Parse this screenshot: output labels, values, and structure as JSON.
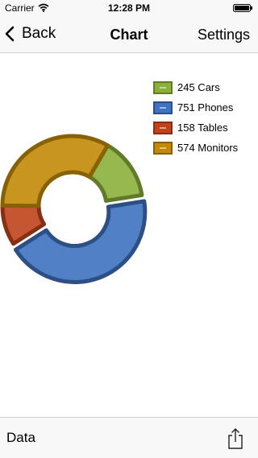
{
  "status_bar": {
    "carrier": "Carrier",
    "time": "12:28 PM",
    "wifi_icon": "wifi-icon",
    "battery_icon": "battery-icon"
  },
  "nav": {
    "back_label": "Back",
    "back_icon": "chevron-left-icon",
    "title": "Chart",
    "settings_label": "Settings"
  },
  "toolbar": {
    "data_label": "Data",
    "share_icon": "share-icon"
  },
  "chart_data": {
    "type": "pie",
    "title": "",
    "legend_position": "top-right",
    "slices": [
      {
        "label": "Cars",
        "value": 245,
        "color": "#8ab03a",
        "legend_text": "245 Cars",
        "exploded": false
      },
      {
        "label": "Phones",
        "value": 751,
        "color": "#3f72c0",
        "legend_text": "751 Phones",
        "exploded": true
      },
      {
        "label": "Tables",
        "value": 158,
        "color": "#c0431b",
        "legend_text": "158 Tables",
        "exploded": false
      },
      {
        "label": "Monitors",
        "value": 574,
        "color": "#c28a06",
        "legend_text": "574 Monitors",
        "exploded": false
      }
    ]
  }
}
